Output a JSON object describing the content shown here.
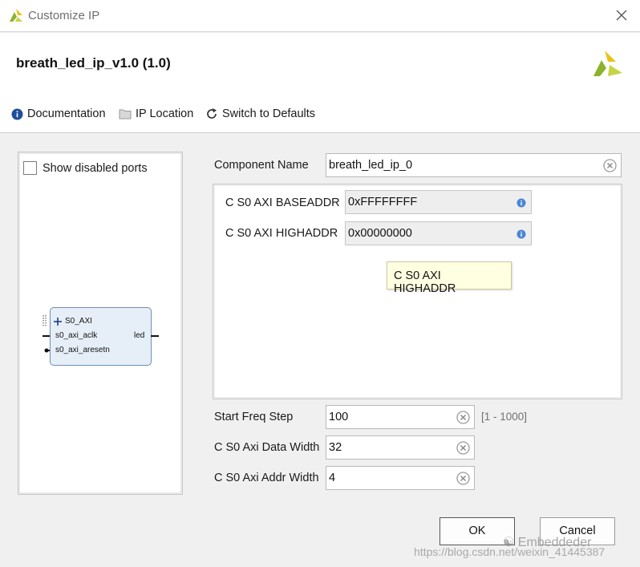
{
  "window": {
    "title": "Customize IP"
  },
  "header": {
    "ip_name": "breath_led_ip_v1.0 (1.0)"
  },
  "toolbar": {
    "documentation": "Documentation",
    "ip_location": "IP Location",
    "switch_defaults": "Switch to Defaults"
  },
  "left_panel": {
    "show_disabled_ports": "Show disabled ports",
    "show_disabled_checked": false,
    "block": {
      "bus_port": "S0_AXI",
      "port_clk": "s0_axi_aclk",
      "port_resetn": "s0_axi_aresetn",
      "port_led": "led"
    }
  },
  "form": {
    "component_name_label": "Component Name",
    "component_name_value": "breath_led_ip_0",
    "baseaddr_label": "C S0 AXI BASEADDR",
    "baseaddr_value": "0xFFFFFFFF",
    "highaddr_label": "C S0 AXI HIGHADDR",
    "highaddr_value": "0x00000000",
    "tooltip": "C S0 AXI HIGHADDR",
    "start_freq_label": "Start Freq Step",
    "start_freq_value": "100",
    "start_freq_range": "[1 - 1000]",
    "data_width_label": "C S0 Axi Data Width",
    "data_width_value": "32",
    "addr_width_label": "C S0 Axi Addr Width",
    "addr_width_value": "4"
  },
  "buttons": {
    "ok": "OK",
    "cancel": "Cancel"
  },
  "watermark": {
    "brand": "Embeddeder",
    "url": "https://blog.csdn.net/weixin_41445387"
  },
  "colors": {
    "accent_blue": "#1f4e9c",
    "tooltip_bg": "#ffffe1",
    "block_fill": "#e6eef8",
    "logo_green": "#8bb32e",
    "logo_yellow": "#e8c21b"
  }
}
